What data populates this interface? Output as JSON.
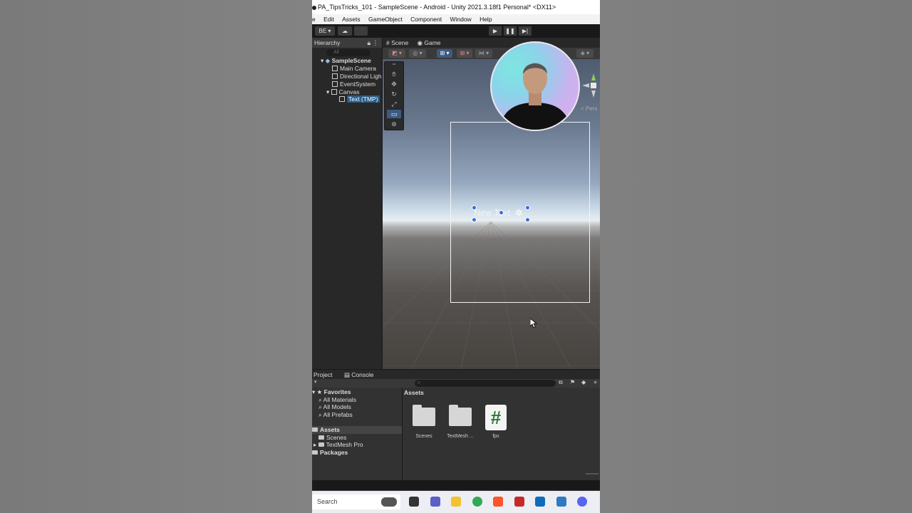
{
  "window": {
    "title": "PA_TipsTricks_101 - SampleScene - Android - Unity 2021.3.18f1 Personal* <DX11>"
  },
  "menu": [
    "e",
    "Edit",
    "Assets",
    "GameObject",
    "Component",
    "Window",
    "Help"
  ],
  "toolbar": {
    "account": "BE"
  },
  "hierarchy": {
    "tab": "Hierarchy",
    "search_placeholder": "All",
    "scene": "SampleScene",
    "items": [
      "Main Camera",
      "Directional Ligh",
      "EventSystem",
      "Canvas",
      "Text (TMP)"
    ],
    "selected": "Text (TMP)"
  },
  "scene": {
    "tabs": [
      "Scene",
      "Game"
    ],
    "active_tab": "Scene",
    "text_object": "New Text",
    "persp_label": "< Pers"
  },
  "project": {
    "tabs": [
      "Project",
      "Console"
    ],
    "active_tab": "Project",
    "favorites": {
      "label": "Favorites",
      "items": [
        "All Materials",
        "All Models",
        "All Prefabs"
      ]
    },
    "assets_tree": {
      "label": "Assets",
      "items": [
        "Scenes",
        "TextMesh Pro"
      ]
    },
    "packages_label": "Packages",
    "breadcrumb": "Assets",
    "asset_items": [
      "Scenes",
      "TextMesh ...",
      "fps"
    ]
  },
  "taskbar": {
    "search_placeholder": "Search"
  },
  "colors": {
    "accent": "#3b5a84",
    "selection": "#2c5d87",
    "editor_bg": "#383838",
    "panel_bg": "#282828"
  }
}
